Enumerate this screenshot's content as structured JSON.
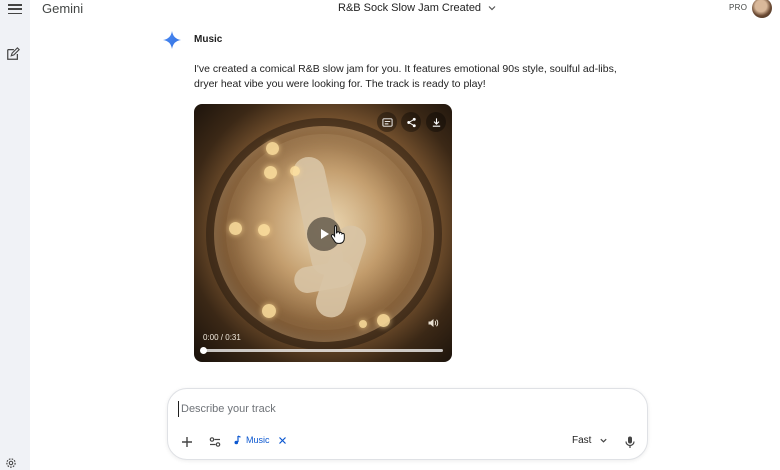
{
  "header": {
    "app_name": "Gemini",
    "chat_title": "R&B Sock Slow Jam Created",
    "plan_badge": "PRO"
  },
  "response": {
    "sender": "Music",
    "text": "I've created a comical R&B slow jam for you. It features emotional 90s style, soulful ad-libs, dryer heat vibe you were looking for. The track is ready to play!"
  },
  "player": {
    "time": "0:00 / 0:31",
    "progress_fraction": 0.0
  },
  "composer": {
    "placeholder": "Describe your track",
    "value": "",
    "tool_chip": "Music",
    "mode": "Fast"
  },
  "colors": {
    "accent": "#0b57d0",
    "sidebar_bg": "#f0f2f6"
  }
}
